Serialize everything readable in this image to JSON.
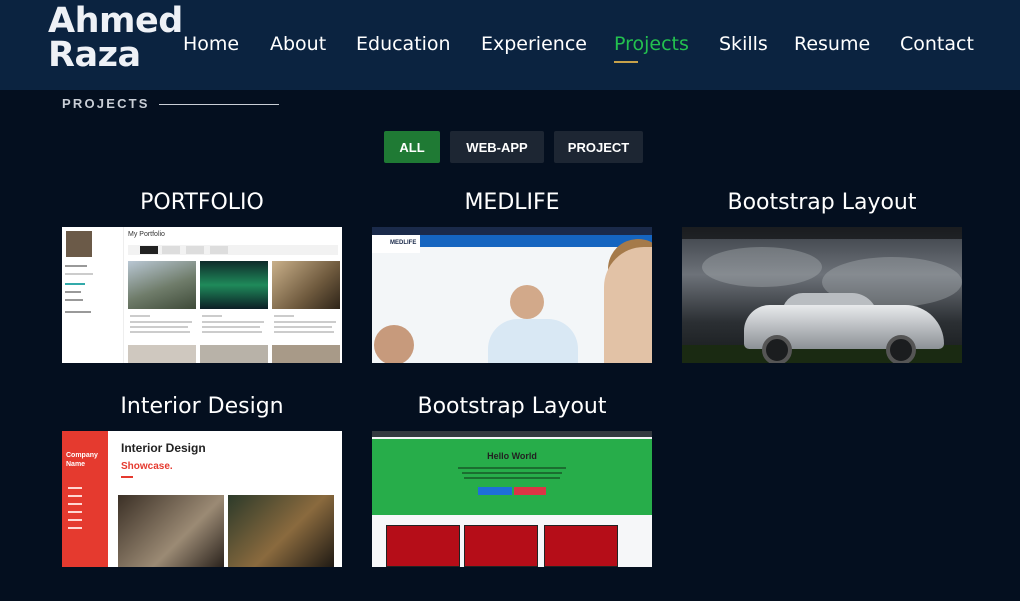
{
  "brand": {
    "line1": "Ahmed",
    "line2": "Raza"
  },
  "nav": {
    "items": [
      {
        "label": "Home"
      },
      {
        "label": "About"
      },
      {
        "label": "Education"
      },
      {
        "label": "Experience"
      },
      {
        "label": "Projects",
        "active": true
      },
      {
        "label": "Skills"
      },
      {
        "label": "Resume"
      },
      {
        "label": "Contact"
      }
    ]
  },
  "section": {
    "title": "PROJECTS"
  },
  "filters": [
    {
      "label": "ALL",
      "active": true
    },
    {
      "label": "WEB-APP"
    },
    {
      "label": "PROJECT"
    }
  ],
  "projects": [
    {
      "title": "PORTFOLIO",
      "thumb_text": {
        "header": "My Portfolio"
      }
    },
    {
      "title": "MEDLIFE",
      "thumb_text": {
        "logo": "MEDLIFE"
      }
    },
    {
      "title": "Bootstrap Layout"
    },
    {
      "title": "Interior Design",
      "thumb_text": {
        "company": "Company Name",
        "heading": "Interior Design",
        "sub": "Showcase."
      }
    },
    {
      "title": "Bootstrap Layout",
      "thumb_text": {
        "heading": "Hello World"
      }
    }
  ],
  "colors": {
    "nav_bg": "#0b2340",
    "page_bg": "#040f1f",
    "active_green": "#23c14f",
    "filter_active": "#1f7a34",
    "filter_inactive": "#1d2633"
  }
}
